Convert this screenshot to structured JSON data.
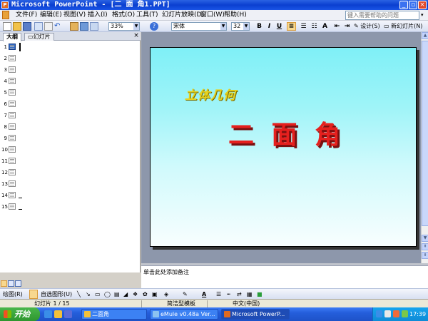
{
  "window": {
    "title": "Microsoft PowerPoint - [二 面 角1.PPT]",
    "app_icon": "powerpoint-icon"
  },
  "menu": {
    "items": [
      "文件(F)",
      "编辑(E)",
      "视图(V)",
      "插入(I)",
      "格式(O)",
      "工具(T)",
      "幻灯片放映(D)",
      "窗口(W)",
      "帮助(H)"
    ],
    "help_placeholder": "键入需要帮助的问题"
  },
  "toolbar": {
    "zoom": "33%",
    "font_name": "宋体",
    "font_size": "32",
    "bold": "B",
    "italic": "I",
    "underline": "U",
    "design_label": "设计(S)",
    "new_slide_label": "新幻灯片(N)"
  },
  "left_pane": {
    "tabs": [
      "大纲",
      "幻灯片"
    ],
    "close_glyph": "×",
    "slides": [
      "1",
      "2",
      "3",
      "4",
      "5",
      "6",
      "7",
      "8",
      "9",
      "10",
      "11",
      "12",
      "13",
      "14",
      "15"
    ]
  },
  "slide": {
    "subtitle": "立体几何",
    "title": "二 面 角"
  },
  "notes": {
    "placeholder": "单击此处添加备注"
  },
  "drawing_toolbar": {
    "draw_label": "绘图(R)",
    "autoshapes_label": "自选图形(U)"
  },
  "status": {
    "slide_position": "幻灯片 1 / 15",
    "template": "简洁型模板",
    "language": "中文(中国)"
  },
  "taskbar": {
    "start_label": "开始",
    "tasks": [
      "二面角",
      "eMule v0.48a Ver...",
      "Microsoft PowerP..."
    ],
    "clock": "17:39"
  },
  "colors": {
    "titlebar": "#0b3fd0",
    "slide_gradient_top": "#7ff0f7",
    "slide_title": "#e5201e",
    "slide_subtitle": "#e6d21e",
    "taskbar": "#245edb",
    "start_button": "#2e962f"
  }
}
